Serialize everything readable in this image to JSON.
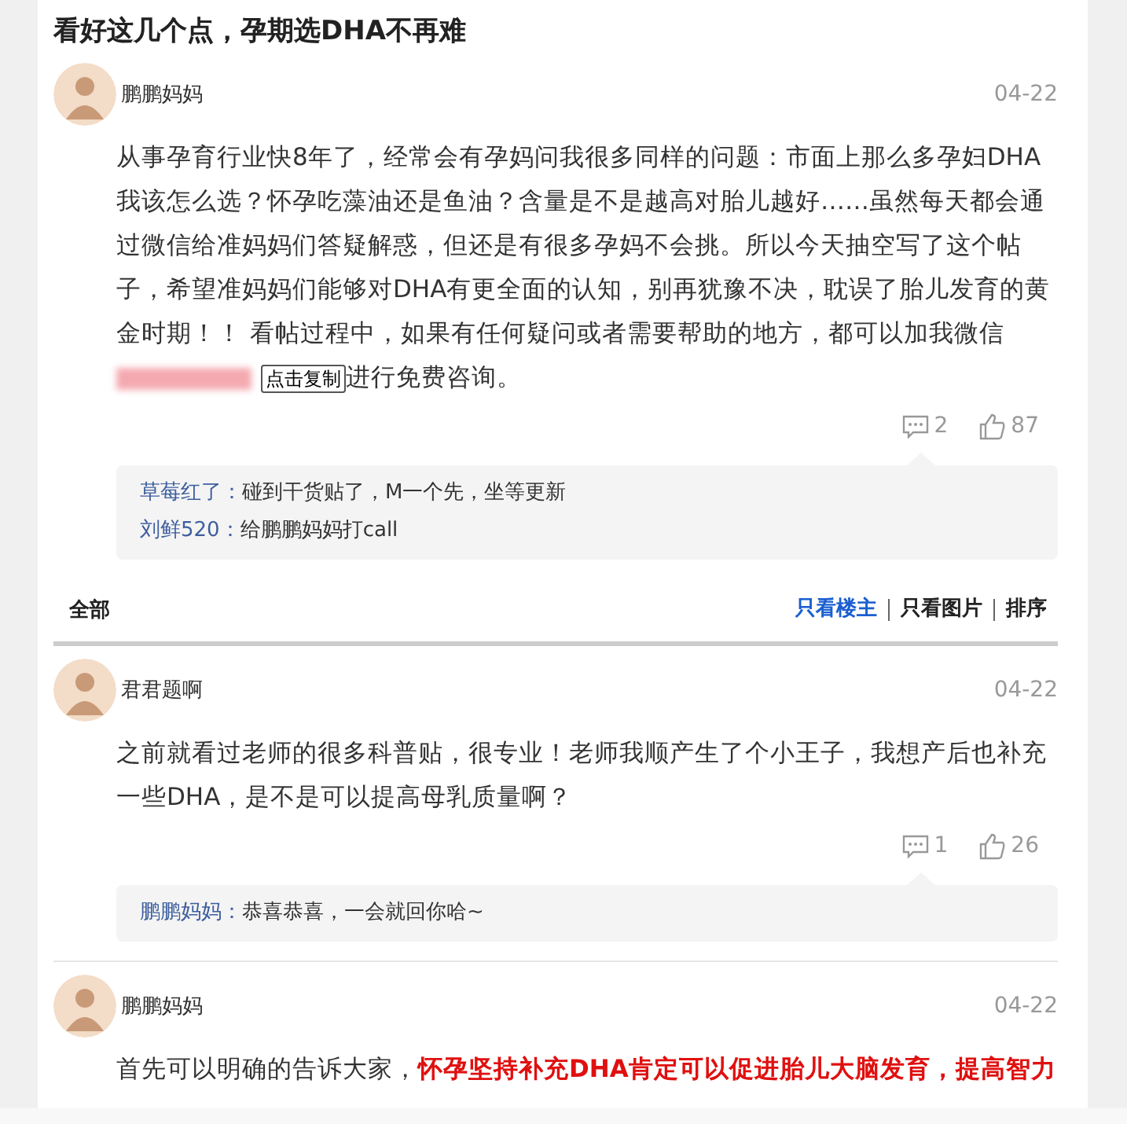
{
  "title": "看好这几个点，孕期选DHA不再难",
  "main_post": {
    "author": "鹏鹏妈妈",
    "date": "04-22",
    "body": [
      {
        "kind": "text",
        "text": "从事孕育行业快8年了，经常会有孕妈问我很多同样的问题：市面上那么多孕妇DHA我该怎么选？怀孕吃藻油还是鱼油？含量是不是越高对胎儿越好……虽然每天都会通过微信给准妈妈们答疑解惑，但还是有很多孕妈不会挑。所以今天抽空写了这个帖子，希望准妈妈们能够对DHA有更全面的认知，别再犹豫不决，耽误了胎儿发育的黄金时期！！ 看帖过程中，如果有任何疑问或者需要帮助的地方，都可以加我微信"
      },
      {
        "kind": "redacted"
      },
      {
        "kind": "copy_button",
        "text": "点击复制"
      },
      {
        "kind": "text",
        "text": "进行免费咨询。"
      }
    ],
    "comments": "2",
    "likes": "87",
    "replies": [
      {
        "author": "草莓红了",
        "sep": "：",
        "text": "碰到干货贴了，M一个先，坐等更新"
      },
      {
        "author": "刘鲜520",
        "sep": "：",
        "text": "给鹏鹏妈妈打call"
      }
    ]
  },
  "filter_bar": {
    "label": "全部",
    "options": [
      {
        "label": "只看楼主",
        "selected": true
      },
      {
        "label": "只看图片",
        "selected": false
      },
      {
        "label": "排序",
        "selected": false
      }
    ]
  },
  "floors": [
    {
      "author": "君君题啊",
      "date": "04-22",
      "body": [
        {
          "kind": "text",
          "text": "之前就看过老师的很多科普贴，很专业！老师我顺产生了个小王子，我想产后也补充一些DHA，是不是可以提高母乳质量啊？"
        }
      ],
      "comments": "1",
      "likes": "26",
      "replies": [
        {
          "author": "鹏鹏妈妈",
          "sep": "：",
          "text": "恭喜恭喜，一会就回你哈~"
        }
      ]
    },
    {
      "author": "鹏鹏妈妈",
      "date": "04-22",
      "body": [
        {
          "kind": "text",
          "text": "首先可以明确的告诉大家，**怀孕坚持补充DHA肯定可以促进胎儿大脑发育，提高智力**"
        }
      ]
    }
  ]
}
